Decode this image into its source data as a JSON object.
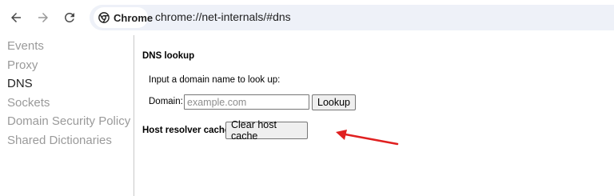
{
  "toolbar": {
    "chip_label": "Chrome",
    "url": "chrome://net-internals/#dns",
    "icons": {
      "back": "arrow-left-icon",
      "forward": "arrow-right-icon",
      "reload": "reload-icon",
      "chip": "chrome-logo-icon"
    }
  },
  "sidebar": {
    "items": [
      {
        "label": "Events"
      },
      {
        "label": "Proxy"
      },
      {
        "label": "DNS",
        "selected": true
      },
      {
        "label": "Sockets"
      },
      {
        "label": "Domain Security Policy"
      },
      {
        "label": "Shared Dictionaries"
      }
    ]
  },
  "main": {
    "section_title": "DNS lookup",
    "instruction": "Input a domain name to look up:",
    "domain_label": "Domain:",
    "domain_input": {
      "value": "",
      "placeholder": "example.com"
    },
    "lookup_button": "Lookup",
    "host_cache_label": "Host resolver cache",
    "clear_button": "Clear host cache"
  },
  "annotation": {
    "color": "#e02020"
  }
}
